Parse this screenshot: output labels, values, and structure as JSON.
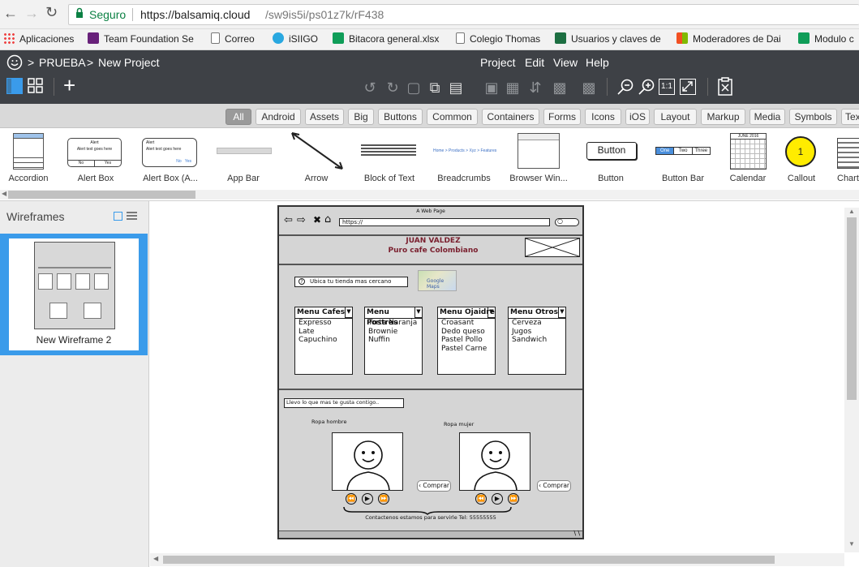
{
  "browser": {
    "secure_label": "Seguro",
    "url_host": "https://balsamiq.cloud",
    "url_path": "/sw9is5i/ps01z7k/rF438",
    "bookmarks": [
      {
        "label": "Aplicaciones",
        "icon": "apps-grid-icon",
        "color": "#e44"
      },
      {
        "label": "Team Foundation Se",
        "icon": "visual-studio-icon",
        "color": "#68217a"
      },
      {
        "label": "Correo",
        "icon": "page-icon",
        "color": "#888"
      },
      {
        "label": "iSIIGO",
        "icon": "siigo-icon",
        "color": "#29a8e0"
      },
      {
        "label": "Bitacora general.xlsx",
        "icon": "sheets-icon",
        "color": "#0f9d58"
      },
      {
        "label": "Colegio Thomas",
        "icon": "page-icon",
        "color": "#888"
      },
      {
        "label": "Usuarios y claves de",
        "icon": "excel-icon",
        "color": "#1d6f42"
      },
      {
        "label": "Moderadores de Dai",
        "icon": "windows-icon",
        "color": "#f25022"
      },
      {
        "label": "Modulo c",
        "icon": "sheets-icon",
        "color": "#0f9d58"
      }
    ]
  },
  "app": {
    "breadcrumb": [
      ">",
      "PRUEBA",
      ">",
      "New Project"
    ],
    "menu": [
      "Project",
      "Edit",
      "View",
      "Help"
    ]
  },
  "categories": [
    "All",
    "Android",
    "Assets",
    "Big",
    "Buttons",
    "Common",
    "Containers",
    "Forms",
    "Icons",
    "iOS",
    "Layout",
    "Markup",
    "Media",
    "Symbols",
    "Tex"
  ],
  "components": [
    "Accordion",
    "Alert Box",
    "Alert Box (A...",
    "App Bar",
    "Arrow",
    "Block of Text",
    "Breadcrumbs",
    "Browser Win...",
    "Button",
    "Button Bar",
    "Calendar",
    "Callout",
    "Chart"
  ],
  "component_texts": {
    "button": "Button",
    "buttonbar": [
      "One",
      "Two",
      "Three"
    ],
    "callout": "1",
    "calendar_month": "JUNE 2016",
    "alert_title": "Alert",
    "alert_text": "Alert text goes here",
    "alert_no": "No",
    "alert_yes": "Yes",
    "breadcrumbs": "Home > Products > Xyz > Features"
  },
  "leftpanel": {
    "title": "Wireframes",
    "wireframe_name": "New Wireframe 2"
  },
  "mockup": {
    "window_title": "A Web Page",
    "url": "https://",
    "brand_name": "JUAN VALDEZ",
    "brand_tagline": "Puro cafe Colombiano",
    "store_locator": "Ubica tu tienda mas cercano",
    "map_label": "Google Maps",
    "menus": [
      {
        "title": "Menu Cafes",
        "items": [
          "Expresso",
          "Late",
          "Capuchino"
        ]
      },
      {
        "title": "Menu Postres",
        "items": [
          "Torta Naranja",
          "Brownie",
          "Nuffin"
        ]
      },
      {
        "title": "Menu Ojaidre",
        "items": [
          "Croasant",
          "Dedo queso",
          "Pastel Pollo",
          "Pastel Carne"
        ]
      },
      {
        "title": "Menu Otros",
        "items": [
          "Cerveza",
          "Jugos",
          "Sandwich"
        ]
      }
    ],
    "promo_text": "Llevo lo que mas te gusta contigo..",
    "section_men": "Ropa hombre",
    "section_women": "Ropa mujer",
    "buy_label": "Comprar",
    "footer": "Contactenos estamos para servirle Tel: 55555555"
  },
  "colors": {
    "app_header": "#3e4146",
    "selected_thumb": "#3a9bea",
    "brand_text": "#7a1f2e"
  }
}
